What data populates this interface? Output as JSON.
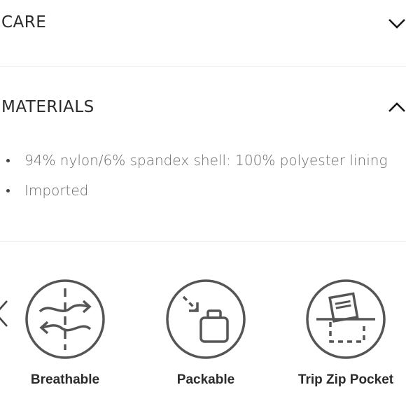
{
  "sections": {
    "care": {
      "title": "CARE",
      "state": "collapsed"
    },
    "materials": {
      "title": "MATERIALS",
      "state": "expanded",
      "items": [
        "94% nylon/6% spandex shell: 100% polyester lining",
        "Imported"
      ]
    }
  },
  "features": [
    {
      "label": "Breathable",
      "icon": "breathable-icon"
    },
    {
      "label": "Packable",
      "icon": "packable-icon"
    },
    {
      "label": "Trip Zip Pocket",
      "icon": "trip-zip-pocket-icon"
    }
  ],
  "carousel": {
    "prev_icon": "chevron-left-icon"
  },
  "colors": {
    "icon_stroke": "#555555",
    "text": "#2b2b2b",
    "muted_text": "#6a6a6a",
    "divider": "#e6e6e6"
  }
}
